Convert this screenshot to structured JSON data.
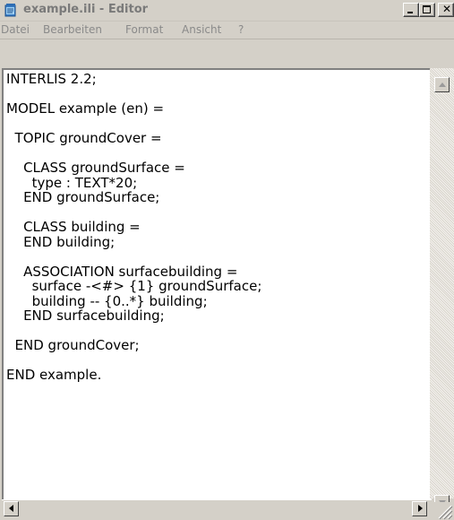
{
  "window": {
    "title": "example.ili - Editor"
  },
  "menu": {
    "items": [
      "Datei",
      "Bearbeiten",
      "Format",
      "Ansicht",
      "?"
    ]
  },
  "editor": {
    "content": "INTERLIS 2.2;\n\nMODEL example (en) =\n\n  TOPIC groundCover =\n\n    CLASS groundSurface =\n      type : TEXT*20;\n    END groundSurface;\n\n    CLASS building =\n    END building;\n\n    ASSOCIATION surfacebuilding =\n      surface -<#> {1} groundSurface;\n      building -- {0..*} building;\n    END surfacebuilding;\n\n  END groundCover;\n\nEND example."
  },
  "icons": {
    "app": "notepad-icon",
    "minimize": "minimize-icon",
    "maximize": "maximize-icon",
    "close": "close-icon"
  },
  "colors": {
    "chrome": "#d4d0c8",
    "editor_bg": "#ffffff",
    "title_text": "#7a7a7a"
  }
}
